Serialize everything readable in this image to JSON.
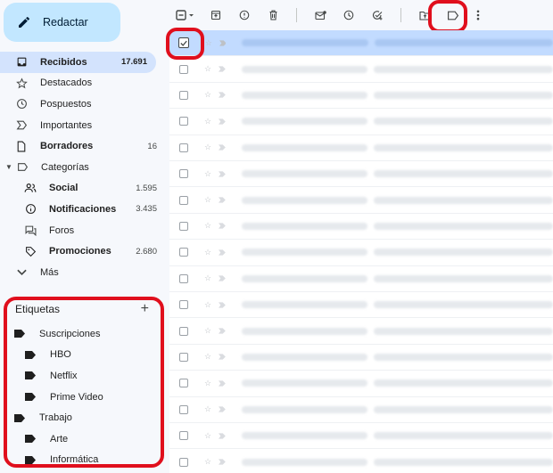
{
  "compose": {
    "label": "Redactar",
    "icon": "pencil-icon"
  },
  "nav": [
    {
      "label": "Recibidos",
      "count": "17.691",
      "icon": "inbox-icon",
      "active": true,
      "bold": true
    },
    {
      "label": "Destacados",
      "count": "",
      "icon": "star-icon"
    },
    {
      "label": "Pospuestos",
      "count": "",
      "icon": "clock-icon"
    },
    {
      "label": "Importantes",
      "count": "",
      "icon": "important-icon"
    },
    {
      "label": "Borradores",
      "count": "16",
      "icon": "file-icon",
      "bold": true
    },
    {
      "label": "Categorías",
      "count": "",
      "icon": "label-icon"
    },
    {
      "label": "Social",
      "count": "1.595",
      "icon": "people-icon",
      "bold": true
    },
    {
      "label": "Notificaciones",
      "count": "3.435",
      "icon": "info-icon",
      "bold": true
    },
    {
      "label": "Foros",
      "count": "",
      "icon": "forum-icon"
    },
    {
      "label": "Promociones",
      "count": "2.680",
      "icon": "tag-icon",
      "bold": true
    },
    {
      "label": "Más",
      "count": "",
      "icon": "chevron-down-icon"
    }
  ],
  "labels": {
    "title": "Etiquetas",
    "add": "+",
    "items": [
      {
        "label": "Suscripciones",
        "level": 0
      },
      {
        "label": "HBO",
        "level": 1
      },
      {
        "label": "Netflix",
        "level": 1
      },
      {
        "label": "Prime Video",
        "level": 1
      },
      {
        "label": "Trabajo",
        "level": 0
      },
      {
        "label": "Arte",
        "level": 1
      },
      {
        "label": "Informática",
        "level": 1
      }
    ]
  },
  "toolbar": {
    "icons": [
      "select-checkbox-icon",
      "archive-icon",
      "report-spam-icon",
      "delete-icon",
      "mark-unread-icon",
      "snooze-icon",
      "add-to-tasks-icon",
      "move-to-icon",
      "label-icon",
      "more-vert-icon"
    ]
  },
  "colors": {
    "accent_red": "#e00f1d",
    "compose_bg": "#c2e7ff",
    "active_bg": "#d3e3fd",
    "selected_row": "#c2dbff"
  },
  "email_rows": {
    "count": 17,
    "selected_index": 0
  }
}
